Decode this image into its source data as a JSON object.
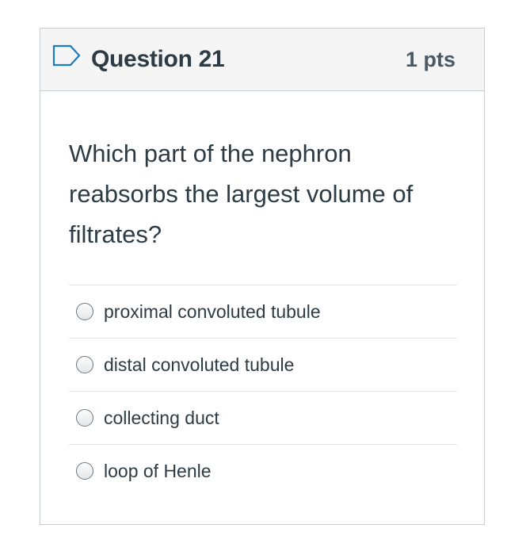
{
  "question": {
    "title": "Question 21",
    "points": "1 pts",
    "text": "Which part of the nephron reabsorbs the largest volume of filtrates?",
    "flag_icon": "flag-outline-icon",
    "accent_color": "#1d7bc1"
  },
  "answers": [
    {
      "label": "proximal convoluted tubule",
      "selected": false
    },
    {
      "label": "distal convoluted tubule",
      "selected": false
    },
    {
      "label": "collecting duct",
      "selected": false
    },
    {
      "label": "loop of Henle",
      "selected": false
    }
  ]
}
